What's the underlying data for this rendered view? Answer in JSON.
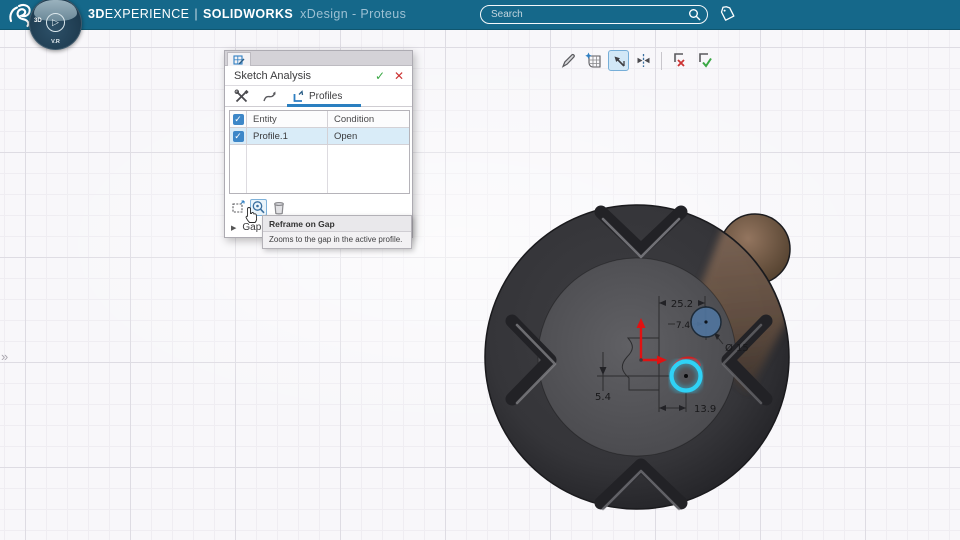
{
  "titlebar": {
    "brand_bold1": "3D",
    "brand_reg1": "EXPERIENCE",
    "separator": "|",
    "brand_bold2": "SOLIDWORKS",
    "app_name": "xDesign - Proteus"
  },
  "search": {
    "placeholder": "Search"
  },
  "compass": {
    "left_label": "3D",
    "bottom_label": "V.R",
    "play_glyph": "▷"
  },
  "viewport_toolbar": {
    "icons": [
      "sketch-edit",
      "snap-grid",
      "normal-to-view",
      "auto-dimension",
      "discard-sketch",
      "accept-sketch"
    ]
  },
  "dialog": {
    "title": "Sketch Analysis",
    "accept_glyph": "✓",
    "close_glyph": "✕",
    "tabs": {
      "profiles_label": "Profiles"
    },
    "table": {
      "headers": {
        "entity": "Entity",
        "condition": "Condition"
      },
      "rows": [
        {
          "checked": "✓",
          "entity": "Profile.1",
          "condition": "Open"
        }
      ]
    },
    "actions": [
      "reframe",
      "reframe-on-gap",
      "delete"
    ],
    "gap_label": "Gap",
    "expander_glyph": "▶"
  },
  "tooltip": {
    "title": "Reframe on Gap",
    "body": "Zooms to the gap in the active profile."
  },
  "sketch": {
    "dim_width": "25.2",
    "dim_gap": "7.4",
    "dim_diameter": "Ø 15",
    "dim_height": "5.4",
    "dim_offset": "13.9"
  },
  "panel_expander_glyph": "»",
  "colors": {
    "topbar": "#15688a",
    "accent": "#2a7fc0",
    "gap_highlight": "#2ec8f0",
    "error_red": "#cc3333",
    "ok_green": "#3aa844",
    "copper": "#7a5e4b"
  }
}
